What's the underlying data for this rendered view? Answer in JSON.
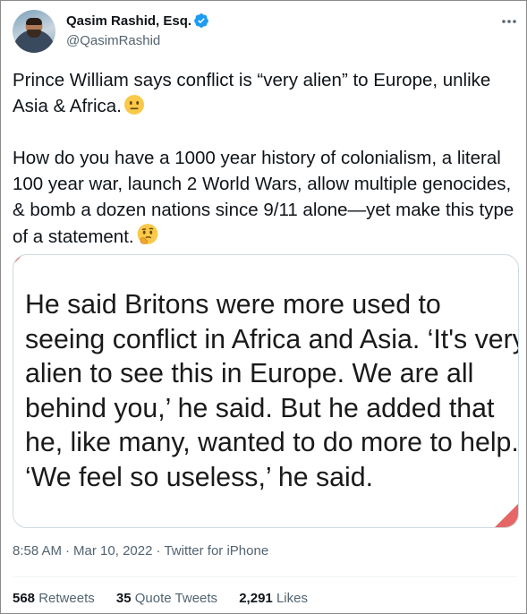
{
  "author": {
    "name": "Qasim Rashid, Esq.",
    "handle": "@QasimRashid",
    "verified": true,
    "verified_color": "#1d9bf0"
  },
  "tweet": {
    "paragraph1": "Prince William says conflict is “very alien” to Europe, unlike Asia & Africa.",
    "paragraph1_emoji": "neutral-face-emoji",
    "paragraph2": "How do you have a 1000 year history of colonialism, a literal 100 year war, launch 2 World Wars, allow multiple genocides, & bomb a dozen nations since 9/11 alone—yet make this type of a statement.",
    "paragraph2_emoji": "thinking-face-emoji"
  },
  "media": {
    "quote_text": "He said Britons were more used to seeing conflict in Africa and Asia. ‘It's very alien to see this in Europe. We are all behind you,’ he said. But he added that he, like many, wanted to do more to help. ‘We feel so useless,’ he said."
  },
  "meta": {
    "time": "8:58 AM",
    "separator": "·",
    "date": "Mar 10, 2022",
    "source": "Twitter for iPhone"
  },
  "stats": {
    "retweets_count": "568",
    "retweets_label": "Retweets",
    "quote_tweets_count": "35",
    "quote_tweets_label": "Quote Tweets",
    "likes_count": "2,291",
    "likes_label": "Likes"
  },
  "colors": {
    "text_primary": "#0f1419",
    "text_secondary": "#536471",
    "accent": "#1d9bf0",
    "media_corner": "#e24b4b"
  }
}
